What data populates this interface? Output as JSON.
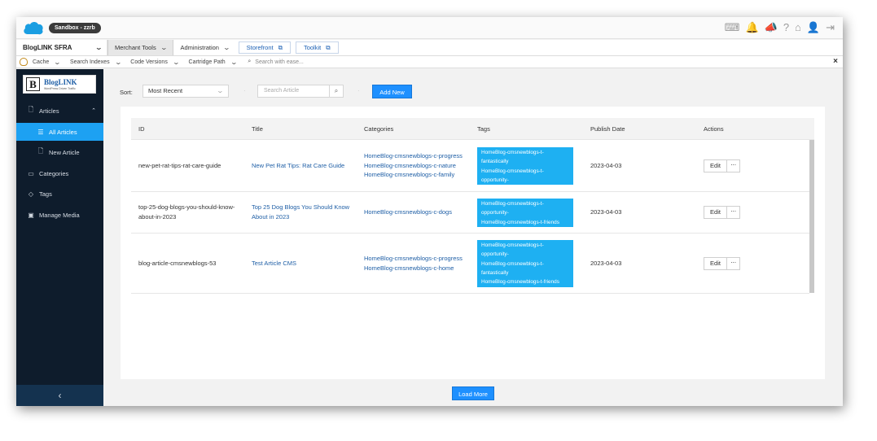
{
  "colors": {
    "accent": "#1da1f2",
    "sidebar_bg": "#0e1c2c",
    "tag_bg": "#1eb0f2",
    "link": "#1f5fa6"
  },
  "topbar": {
    "sandbox_label": "Sandbox - zzrb",
    "icons": [
      "keyboard-icon",
      "notifications-icon",
      "announcement-icon",
      "help-icon",
      "home-icon",
      "user-icon",
      "logout-icon"
    ],
    "icon_glyphs": {
      "keyboard": "⌨",
      "notifications": "🔔",
      "announcement": "📣",
      "help": "?",
      "home": "⌂",
      "user": "👤",
      "logout": "⇥"
    }
  },
  "menubar": {
    "site": "BlogLINK SFRA",
    "merchant_tools": "Merchant Tools",
    "administration": "Administration",
    "storefront": "Storefront",
    "toolkit": "Toolkit"
  },
  "toolbar": {
    "cache": "Cache",
    "search_indexes": "Search Indexes",
    "code_versions": "Code Versions",
    "cartridge_path": "Cartridge Path",
    "search_placeholder": "Search with ease..."
  },
  "sidebar": {
    "logo_letter": "B",
    "logo_name": "BlogLINK",
    "logo_tagline": "WordPress Driven Traffic",
    "items": [
      {
        "label": "Articles",
        "icon": "document-icon"
      },
      {
        "label": "All Articles",
        "icon": "list-icon"
      },
      {
        "label": "New Article",
        "icon": "new-document-icon"
      },
      {
        "label": "Categories",
        "icon": "folder-icon"
      },
      {
        "label": "Tags",
        "icon": "tag-icon"
      },
      {
        "label": "Manage Media",
        "icon": "image-icon"
      }
    ],
    "collapse_glyph": "‹"
  },
  "filters": {
    "sort_label": "Sort:",
    "sort_value": "Most Recent",
    "search_placeholder": "Search Article",
    "add_new": "Add New"
  },
  "table": {
    "columns": [
      "ID",
      "Title",
      "Categories",
      "Tags",
      "Publish Date",
      "Actions"
    ],
    "rows": [
      {
        "id": "new-pet-rat-tips-rat-care-guide",
        "title": "New Pet Rat Tips: Rat Care Guide",
        "categories": [
          "HomeBlog-cmsnewblogs-c-progress",
          "HomeBlog-cmsnewblogs-c-nature",
          "HomeBlog-cmsnewblogs-c-family"
        ],
        "tags": [
          "HomeBlog-cmsnewblogs-t-",
          "fantastically",
          "HomeBlog-cmsnewblogs-t-",
          "opportunity-"
        ],
        "date": "2023-04-03",
        "edit": "Edit",
        "more": "···"
      },
      {
        "id": "top-25-dog-blogs-you-should-know-about-in-2023",
        "title": "Top 25 Dog Blogs You Should Know About in 2023",
        "categories": [
          "HomeBlog-cmsnewblogs-c-dogs"
        ],
        "tags": [
          "HomeBlog-cmsnewblogs-t-",
          "opportunity-",
          "HomeBlog-cmsnewblogs-t-friends"
        ],
        "date": "2023-04-03",
        "edit": "Edit",
        "more": "···"
      },
      {
        "id": "blog-article-cmsnewblogs-53",
        "title": "Test Article CMS",
        "categories": [
          "HomeBlog-cmsnewblogs-c-progress",
          "HomeBlog-cmsnewblogs-c-home"
        ],
        "tags": [
          "HomeBlog-cmsnewblogs-t-",
          "opportunity-",
          "HomeBlog-cmsnewblogs-t-",
          "fantastically",
          "HomeBlog-cmsnewblogs-t-friends"
        ],
        "date": "2023-04-03",
        "edit": "Edit",
        "more": "···"
      }
    ]
  },
  "load_more": "Load More"
}
